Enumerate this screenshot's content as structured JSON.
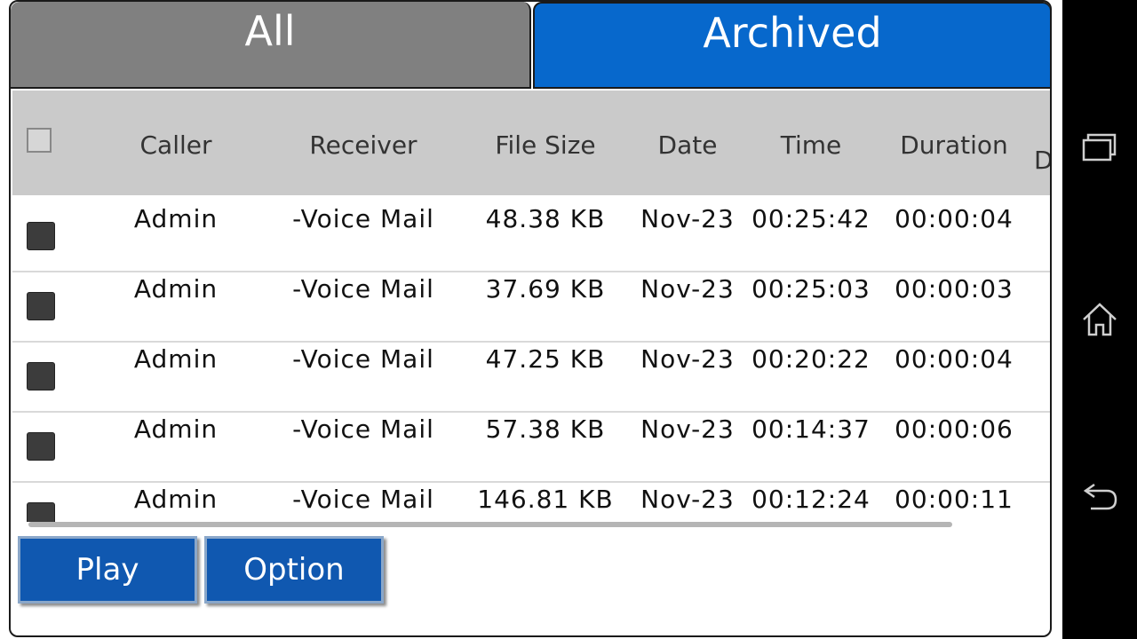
{
  "tabs": {
    "all": "All",
    "archived": "Archived",
    "active": "archived"
  },
  "table": {
    "columns": [
      "Caller",
      "Receiver",
      "File Size",
      "Date",
      "Time",
      "Duration",
      "D"
    ],
    "rows": [
      {
        "caller": "Admin",
        "receiver": "-Voice Mail",
        "file_size": "48.38 KB",
        "date": "Nov-23",
        "time": "00:25:42",
        "duration": "00:00:04"
      },
      {
        "caller": "Admin",
        "receiver": "-Voice Mail",
        "file_size": "37.69 KB",
        "date": "Nov-23",
        "time": "00:25:03",
        "duration": "00:00:03"
      },
      {
        "caller": "Admin",
        "receiver": "-Voice Mail",
        "file_size": "47.25 KB",
        "date": "Nov-23",
        "time": "00:20:22",
        "duration": "00:00:04"
      },
      {
        "caller": "Admin",
        "receiver": "-Voice Mail",
        "file_size": "57.38 KB",
        "date": "Nov-23",
        "time": "00:14:37",
        "duration": "00:00:06"
      },
      {
        "caller": "Admin",
        "receiver": "-Voice Mail",
        "file_size": "146.81 KB",
        "date": "Nov-23",
        "time": "00:12:24",
        "duration": "00:00:11"
      }
    ]
  },
  "buttons": {
    "play": "Play",
    "option": "Option"
  },
  "colors": {
    "tab_active": "#0768cc",
    "tab_inactive": "#808080",
    "header_bg": "#cacaca",
    "button_bg": "#1058b0"
  },
  "navbar": {
    "icons": [
      "recent-apps-icon",
      "home-icon",
      "back-icon"
    ]
  }
}
